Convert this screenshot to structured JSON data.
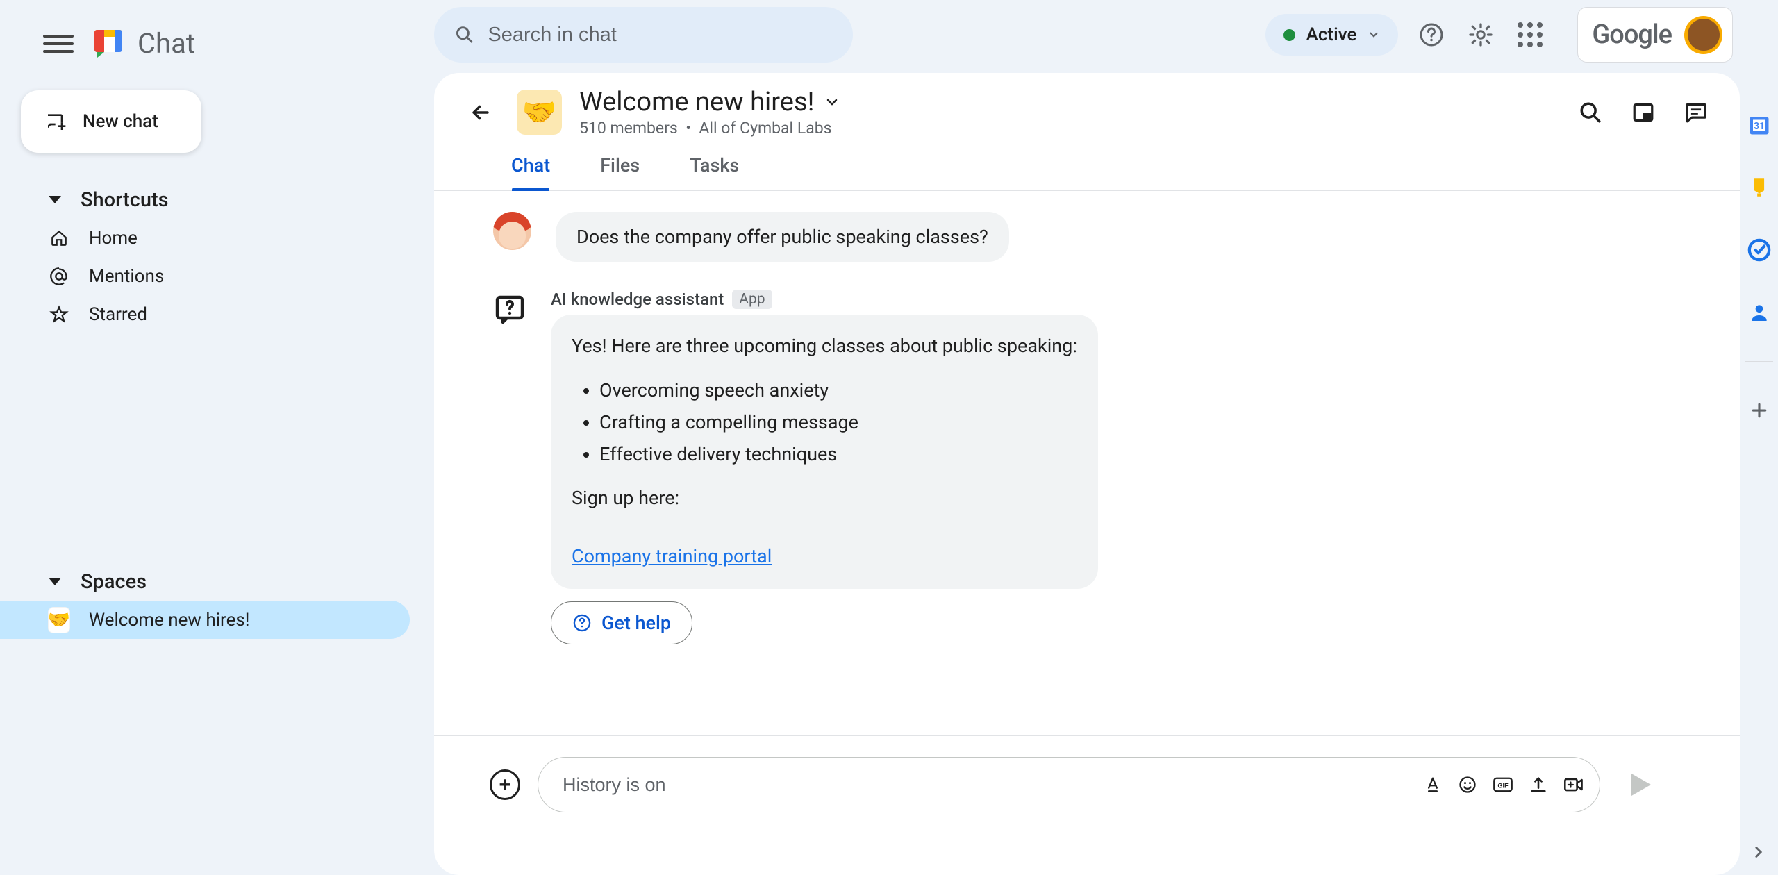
{
  "app": {
    "name": "Chat"
  },
  "search": {
    "placeholder": "Search in chat"
  },
  "status": {
    "label": "Active"
  },
  "new_chat": {
    "label": "New chat"
  },
  "shortcuts": {
    "header": "Shortcuts",
    "home": "Home",
    "mentions": "Mentions",
    "starred": "Starred"
  },
  "spaces": {
    "header": "Spaces",
    "items": [
      {
        "name": "Welcome new hires!",
        "emoji": "🤝",
        "selected": true
      }
    ]
  },
  "space": {
    "emoji": "🤝",
    "title": "Welcome new hires!",
    "members": "510 members",
    "audience": "All of Cymbal Labs"
  },
  "tabs": {
    "chat": "Chat",
    "files": "Files",
    "tasks": "Tasks"
  },
  "messages": {
    "user_q": "Does the company offer public speaking classes?",
    "bot_name": "AI knowledge assistant",
    "bot_tag": "App",
    "bot_intro": "Yes! Here are three upcoming classes about public speaking:",
    "bot_items": {
      "0": "Overcoming speech anxiety",
      "1": "Crafting a compelling message",
      "2": "Effective delivery techniques"
    },
    "bot_signup": "Sign up here:",
    "bot_link": "Company training portal",
    "get_help": "Get help"
  },
  "composer": {
    "placeholder": "History is on"
  },
  "google": {
    "label": "Google"
  }
}
